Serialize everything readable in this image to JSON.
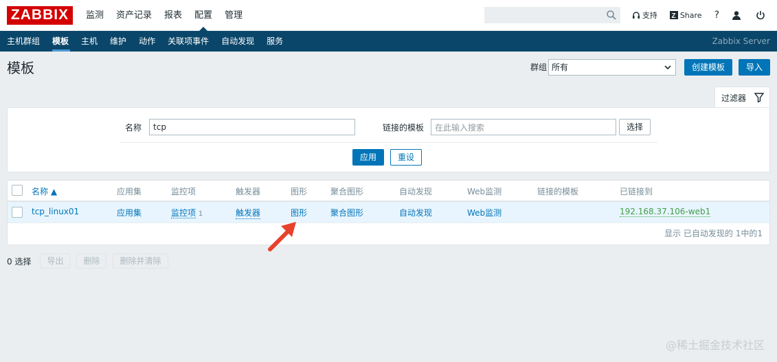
{
  "brand": {
    "logo": "ZABBIX",
    "brand_color": "#d40000"
  },
  "main_nav": [
    {
      "label": "监测"
    },
    {
      "label": "资产记录"
    },
    {
      "label": "报表"
    },
    {
      "label": "配置",
      "active": true
    },
    {
      "label": "管理"
    }
  ],
  "top_tools": {
    "support": "支持",
    "share": "Share",
    "help": "?"
  },
  "sub_nav": {
    "items": [
      "主机群组",
      "模板",
      "主机",
      "维护",
      "动作",
      "关联项事件",
      "自动发现",
      "服务"
    ],
    "active": "模板",
    "server": "Zabbix Server",
    "bar_color": "#0a466a"
  },
  "page": {
    "title": "模板",
    "group_label": "群组",
    "group_value": "所有",
    "create_button": "创建模板",
    "import_button": "导入"
  },
  "filter": {
    "tab_label": "过滤器",
    "name_label": "名称",
    "name_value": "tcp",
    "linked_label": "链接的模板",
    "linked_placeholder": "在此输入搜索",
    "select_button": "选择",
    "apply_button": "应用",
    "reset_button": "重设"
  },
  "table": {
    "headers": [
      "名称 ▲",
      "应用集",
      "监控项",
      "触发器",
      "图形",
      "聚合图形",
      "自动发现",
      "Web监测",
      "链接的模板",
      "已链接到"
    ],
    "rows": [
      {
        "name": "tcp_linux01",
        "applications": "应用集",
        "items": "监控项",
        "items_count": "1",
        "triggers": "触发器",
        "graphs": "图形",
        "screens": "聚合图形",
        "discovery": "自动发现",
        "web": "Web监测",
        "linked_templates": "",
        "linked_to": "192.168.37.106-web1"
      }
    ],
    "footer": "显示 已自动发现的 1中的1"
  },
  "bulk_actions": {
    "selected": "0 选择",
    "export": "导出",
    "delete": "删除",
    "delete_clear": "删除并清除"
  },
  "watermark": "@稀土掘金技术社区",
  "colors": {
    "link": "#0275b8",
    "accent_arrow": "#e8412c",
    "host_link": "#429e47"
  }
}
